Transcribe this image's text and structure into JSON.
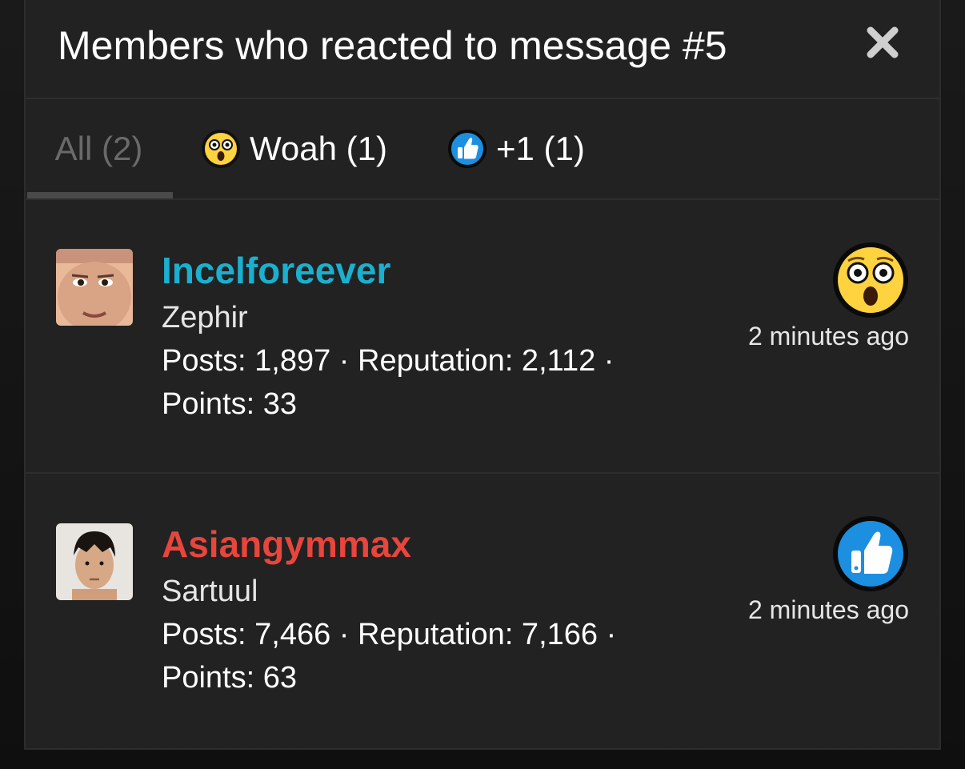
{
  "dialog": {
    "title": "Members who reacted to message #5"
  },
  "tabs": [
    {
      "label": "All (2)",
      "active": true
    },
    {
      "label": "Woah (1)",
      "icon": "woah-emoji-icon"
    },
    {
      "label": "+1 (1)",
      "icon": "thumbs-up-icon"
    }
  ],
  "members": [
    {
      "username": "Incelforeever",
      "username_color": "#1ab0d0",
      "user_title": "Zephir",
      "stats_line": "Posts: 1,897 · Reputation: 2,112 ·",
      "points_line": "Points: 33",
      "reaction_icon": "woah-emoji-icon",
      "time": "2 minutes ago"
    },
    {
      "username": "Asiangymmax",
      "username_color": "#e8453c",
      "user_title": "Sartuul",
      "stats_line": "Posts: 7,466 · Reputation: 7,166 ·",
      "points_line": "Points: 63",
      "reaction_icon": "thumbs-up-icon",
      "time": "2 minutes ago"
    }
  ],
  "colors": {
    "panel": "#222222",
    "text": "#ffffff",
    "muted": "#6a6a6a"
  }
}
